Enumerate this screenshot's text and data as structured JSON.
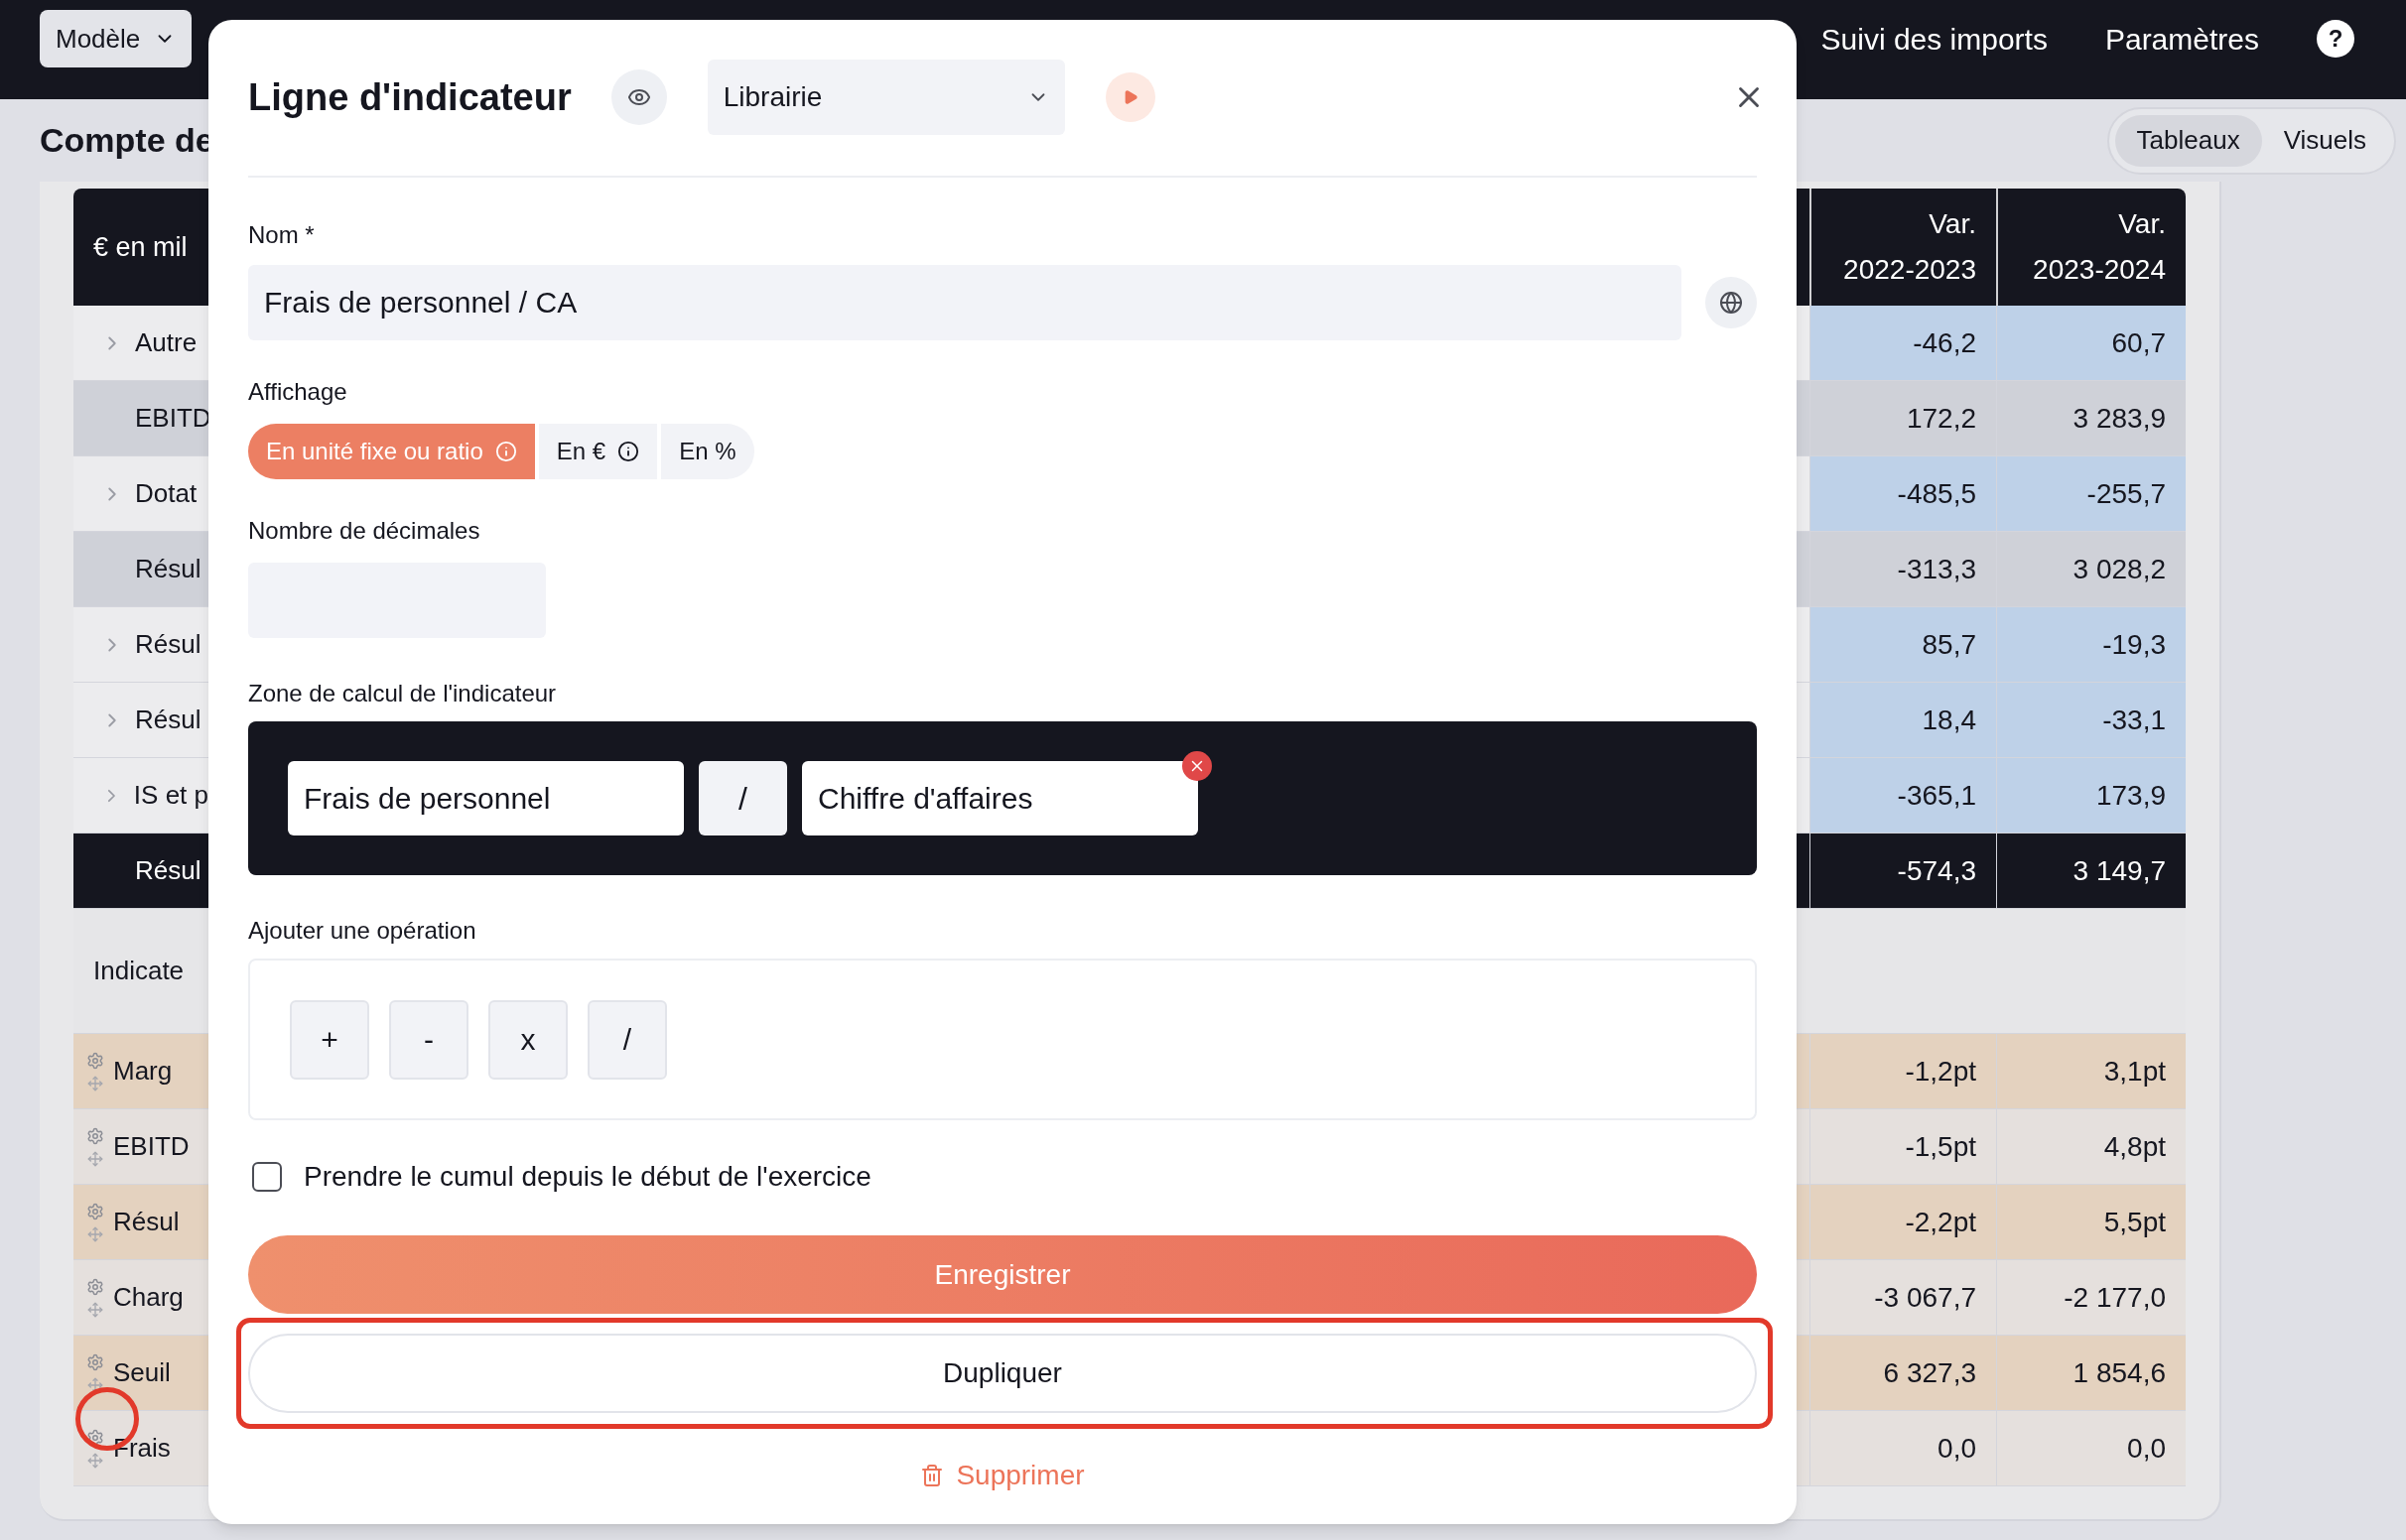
{
  "nav": {
    "model_button": "Modèle",
    "links": [
      "Suivi des imports",
      "Paramètres"
    ],
    "help": "?"
  },
  "page": {
    "title": "Compte de",
    "view_toggle": [
      {
        "label": "Tableaux",
        "selected": true
      },
      {
        "label": "Visuels",
        "selected": false
      }
    ]
  },
  "table": {
    "columns": [
      {
        "label": "€ en mil"
      },
      {
        "label": "Var.",
        "sublabel": "2022-2023"
      },
      {
        "label": "Var.",
        "sublabel": "2023-2024"
      }
    ],
    "rows": [
      {
        "kind": "detail",
        "label": "Autre",
        "values": [
          "-46,2",
          "60,7"
        ]
      },
      {
        "kind": "subtotal",
        "label": "EBITD",
        "values": [
          "172,2",
          "3 283,9"
        ]
      },
      {
        "kind": "detail",
        "label": "Dotat",
        "values": [
          "-485,5",
          "-255,7"
        ]
      },
      {
        "kind": "subtotal",
        "label": "Résul",
        "values": [
          "-313,3",
          "3 028,2"
        ]
      },
      {
        "kind": "detail",
        "label": "Résul",
        "values": [
          "85,7",
          "-19,3"
        ]
      },
      {
        "kind": "detail",
        "label": "Résul",
        "values": [
          "18,4",
          "-33,1"
        ]
      },
      {
        "kind": "detail",
        "label": "IS et p",
        "values": [
          "-365,1",
          "173,9"
        ]
      },
      {
        "kind": "total",
        "label": "Résul",
        "values": [
          "-574,3",
          "3 149,7"
        ]
      },
      {
        "kind": "section",
        "label": "Indicate",
        "values": []
      },
      {
        "kind": "indicator",
        "label": "Marg",
        "color": "#e4d2bf",
        "values": [
          "-1,2pt",
          "3,1pt"
        ]
      },
      {
        "kind": "indicator",
        "label": "EBITD",
        "color": "#e5e0dd",
        "values": [
          "-1,5pt",
          "4,8pt"
        ]
      },
      {
        "kind": "indicator",
        "label": "Résul",
        "color": "#e4d2bf",
        "values": [
          "-2,2pt",
          "5,5pt"
        ]
      },
      {
        "kind": "indicator",
        "label": "Charg",
        "color": "#e5e0dd",
        "values": [
          "-3 067,7",
          "-2 177,0"
        ]
      },
      {
        "kind": "indicator",
        "label": "Seuil",
        "color": "#e4d2bf",
        "values": [
          "6 327,3",
          "1 854,6"
        ]
      },
      {
        "kind": "indicator",
        "label": "Frais",
        "color": "#e5e0dd",
        "values": [
          "0,0",
          "0,0"
        ]
      }
    ]
  },
  "modal": {
    "title": "Ligne d'indicateur",
    "category_select": {
      "value": "Librairie"
    },
    "name_field": {
      "label": "Nom *",
      "value": "Frais de personnel / CA"
    },
    "display": {
      "label": "Affichage",
      "options": [
        {
          "label": "En unité fixe ou ratio",
          "info": true,
          "selected": true
        },
        {
          "label": "En €",
          "info": true,
          "selected": false
        },
        {
          "label": "En %",
          "info": false,
          "selected": false
        }
      ]
    },
    "decimals": {
      "label": "Nombre de décimales"
    },
    "formula": {
      "label": "Zone de calcul de l'indicateur",
      "tokens": [
        {
          "kind": "operand",
          "text": "Frais de personnel",
          "removable": false
        },
        {
          "kind": "operator",
          "text": "/",
          "removable": false
        },
        {
          "kind": "operand",
          "text": "Chiffre d'affaires",
          "removable": true
        }
      ]
    },
    "operations": {
      "label": "Ajouter une opération",
      "buttons": [
        "+",
        "-",
        "x",
        "/"
      ]
    },
    "cumulative": {
      "label": "Prendre le cumul depuis le début de l'exercice",
      "checked": false
    },
    "save_button": "Enregistrer",
    "duplicate_button": "Dupliquer",
    "delete_button": "Supprimer"
  }
}
